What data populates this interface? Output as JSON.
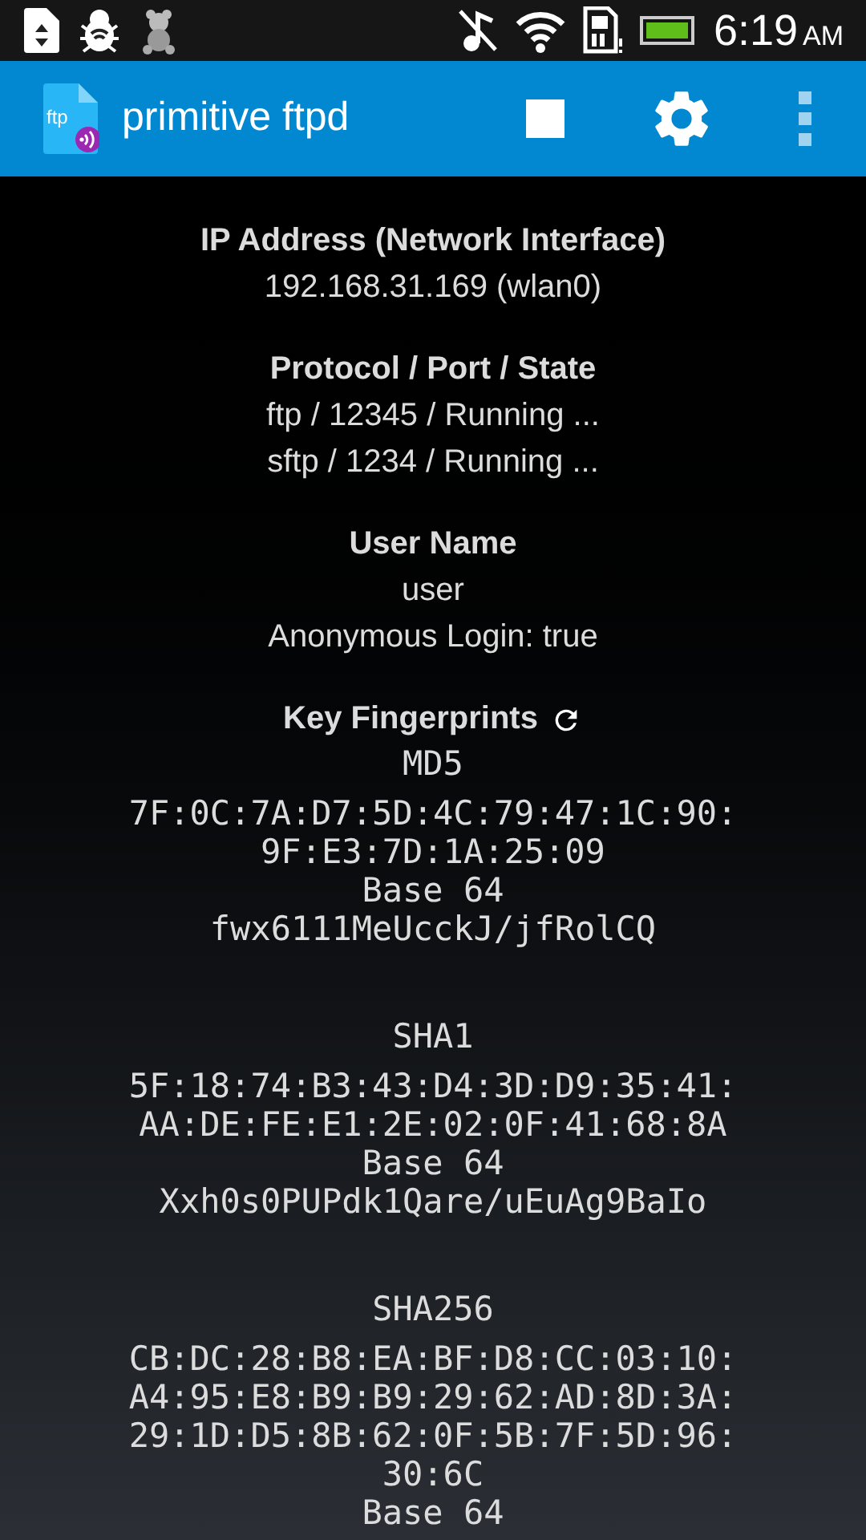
{
  "status_bar": {
    "time": "6:19",
    "meridiem": "AM"
  },
  "app_bar": {
    "title": "primitive ftpd",
    "logo_text": "ftp"
  },
  "sections": [
    {
      "heading": "IP Address (Network Interface)",
      "lines": [
        "192.168.31.169 (wlan0)"
      ]
    },
    {
      "heading": "Protocol / Port / State",
      "lines": [
        "ftp / 12345 / Running ...",
        "sftp / 1234 / Running ..."
      ]
    },
    {
      "heading": "User Name",
      "lines": [
        "user",
        "Anonymous Login: true"
      ]
    }
  ],
  "fingerprints": {
    "heading": "Key Fingerprints",
    "items": [
      {
        "name": "MD5",
        "hex": [
          "7F:0C:7A:D7:5D:4C:79:47:1C:90:",
          "9F:E3:7D:1A:25:09"
        ],
        "base64_label": "Base 64",
        "base64": "fwx6111MeUcckJ/jfRolCQ"
      },
      {
        "name": "SHA1",
        "hex": [
          "5F:18:74:B3:43:D4:3D:D9:35:41:",
          "AA:DE:FE:E1:2E:02:0F:41:68:8A"
        ],
        "base64_label": "Base 64",
        "base64": "Xxh0s0PUPdk1Qare/uEuAg9BaIo"
      },
      {
        "name": "SHA256",
        "hex": [
          "CB:DC:28:B8:EA:BF:D8:CC:03:10:",
          "A4:95:E8:B9:B9:29:62:AD:8D:3A:",
          "29:1D:D5:8B:62:0F:5B:7F:5D:96:",
          "30:6C"
        ],
        "base64_label": "Base 64"
      }
    ]
  }
}
